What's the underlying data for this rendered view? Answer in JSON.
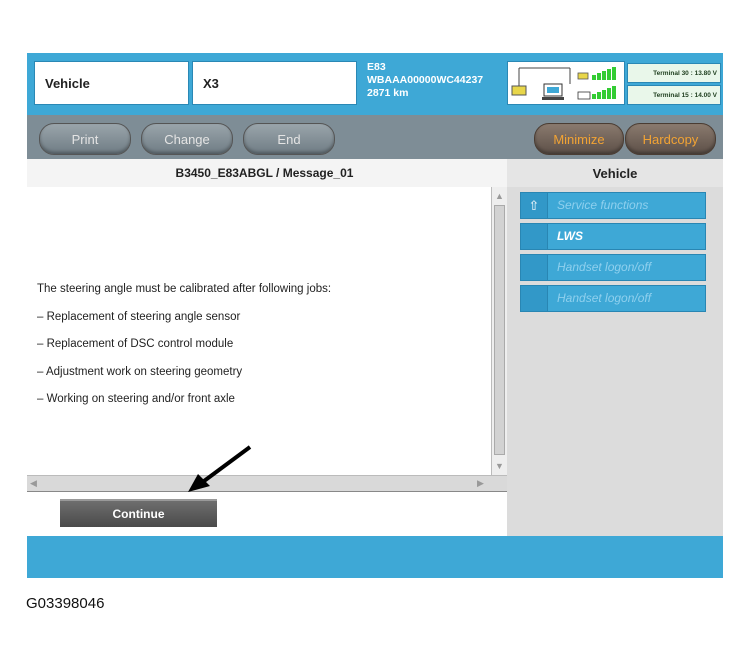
{
  "header": {
    "vehicle_label": "Vehicle",
    "model": "X3",
    "series": "E83",
    "vin": "WBAAA00000WC44237",
    "mileage": "2871 km",
    "terminal30": "Terminal 30 : 13.80 V",
    "terminal15": "Terminal 15 : 14.00 V"
  },
  "toolbar": {
    "print": "Print",
    "change": "Change",
    "end": "End",
    "minimize": "Minimize",
    "hardcopy": "Hardcopy"
  },
  "main": {
    "title": "B3450_E83ABGL / Message_01",
    "lines": [
      "The steering angle must be calibrated after following jobs:",
      "– Replacement of steering angle sensor",
      "– Replacement of DSC control module",
      "– Adjustment work on steering geometry",
      "– Working on steering and/or front axle"
    ],
    "continue": "Continue"
  },
  "sidebar": {
    "title": "Vehicle",
    "items": [
      {
        "label": "Service functions",
        "color": "#8fd0ee"
      },
      {
        "label": "LWS",
        "color": "#ffffff"
      },
      {
        "label": "Handset logon/off",
        "color": "#8fd0ee"
      },
      {
        "label": "Handset logon/off",
        "color": "#8fd0ee"
      }
    ]
  },
  "caption": "G03398046"
}
